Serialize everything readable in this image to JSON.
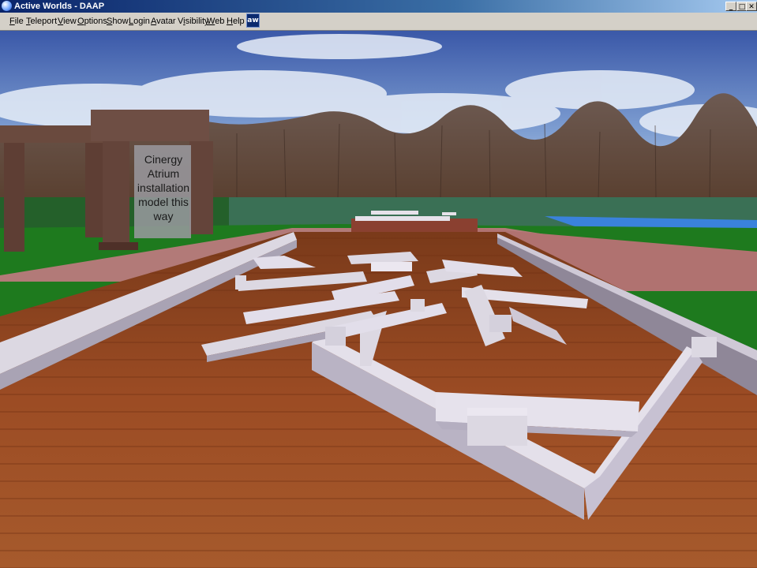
{
  "window": {
    "title": "Active Worlds - DAAP",
    "controls": {
      "minimize": "_",
      "maximize": "□",
      "close": "✕"
    }
  },
  "menu": {
    "items": [
      {
        "id": "file",
        "label": "File",
        "accel": "F",
        "rest": "ile"
      },
      {
        "id": "teleport",
        "label": "Teleport",
        "accel": "T",
        "rest": "eleport"
      },
      {
        "id": "view",
        "label": "View",
        "accel": "V",
        "rest": "iew"
      },
      {
        "id": "options",
        "label": "Options",
        "accel": "O",
        "rest": "ptions"
      },
      {
        "id": "show",
        "label": "Show",
        "accel": "S",
        "rest": "how"
      },
      {
        "id": "login",
        "label": "Login",
        "accel": "L",
        "rest": "ogin"
      },
      {
        "id": "avatar",
        "label": "Avatar",
        "accel": "A",
        "rest": "vatar"
      },
      {
        "id": "visibility",
        "label": "Visibility",
        "accel": "i",
        "pre": "V",
        "rest": "sibility"
      },
      {
        "id": "web",
        "label": "Web",
        "accel": "W",
        "rest": "eb"
      },
      {
        "id": "help",
        "label": "Help",
        "accel": "H",
        "rest": "elp"
      }
    ],
    "logo": "aw"
  },
  "scene": {
    "sign_lines": [
      "Cinergy",
      "Atrium",
      "installation",
      "model this",
      "way"
    ],
    "colors": {
      "sky_top": "#3f5fae",
      "sky_bottom": "#b9cde6",
      "floor": "#9a4a22",
      "walkway": "#b07a78",
      "grass": "#1a7a1a",
      "hedge": "#2f6e45",
      "water": "#3a7fd6",
      "beam": "#dcd8e2"
    }
  }
}
